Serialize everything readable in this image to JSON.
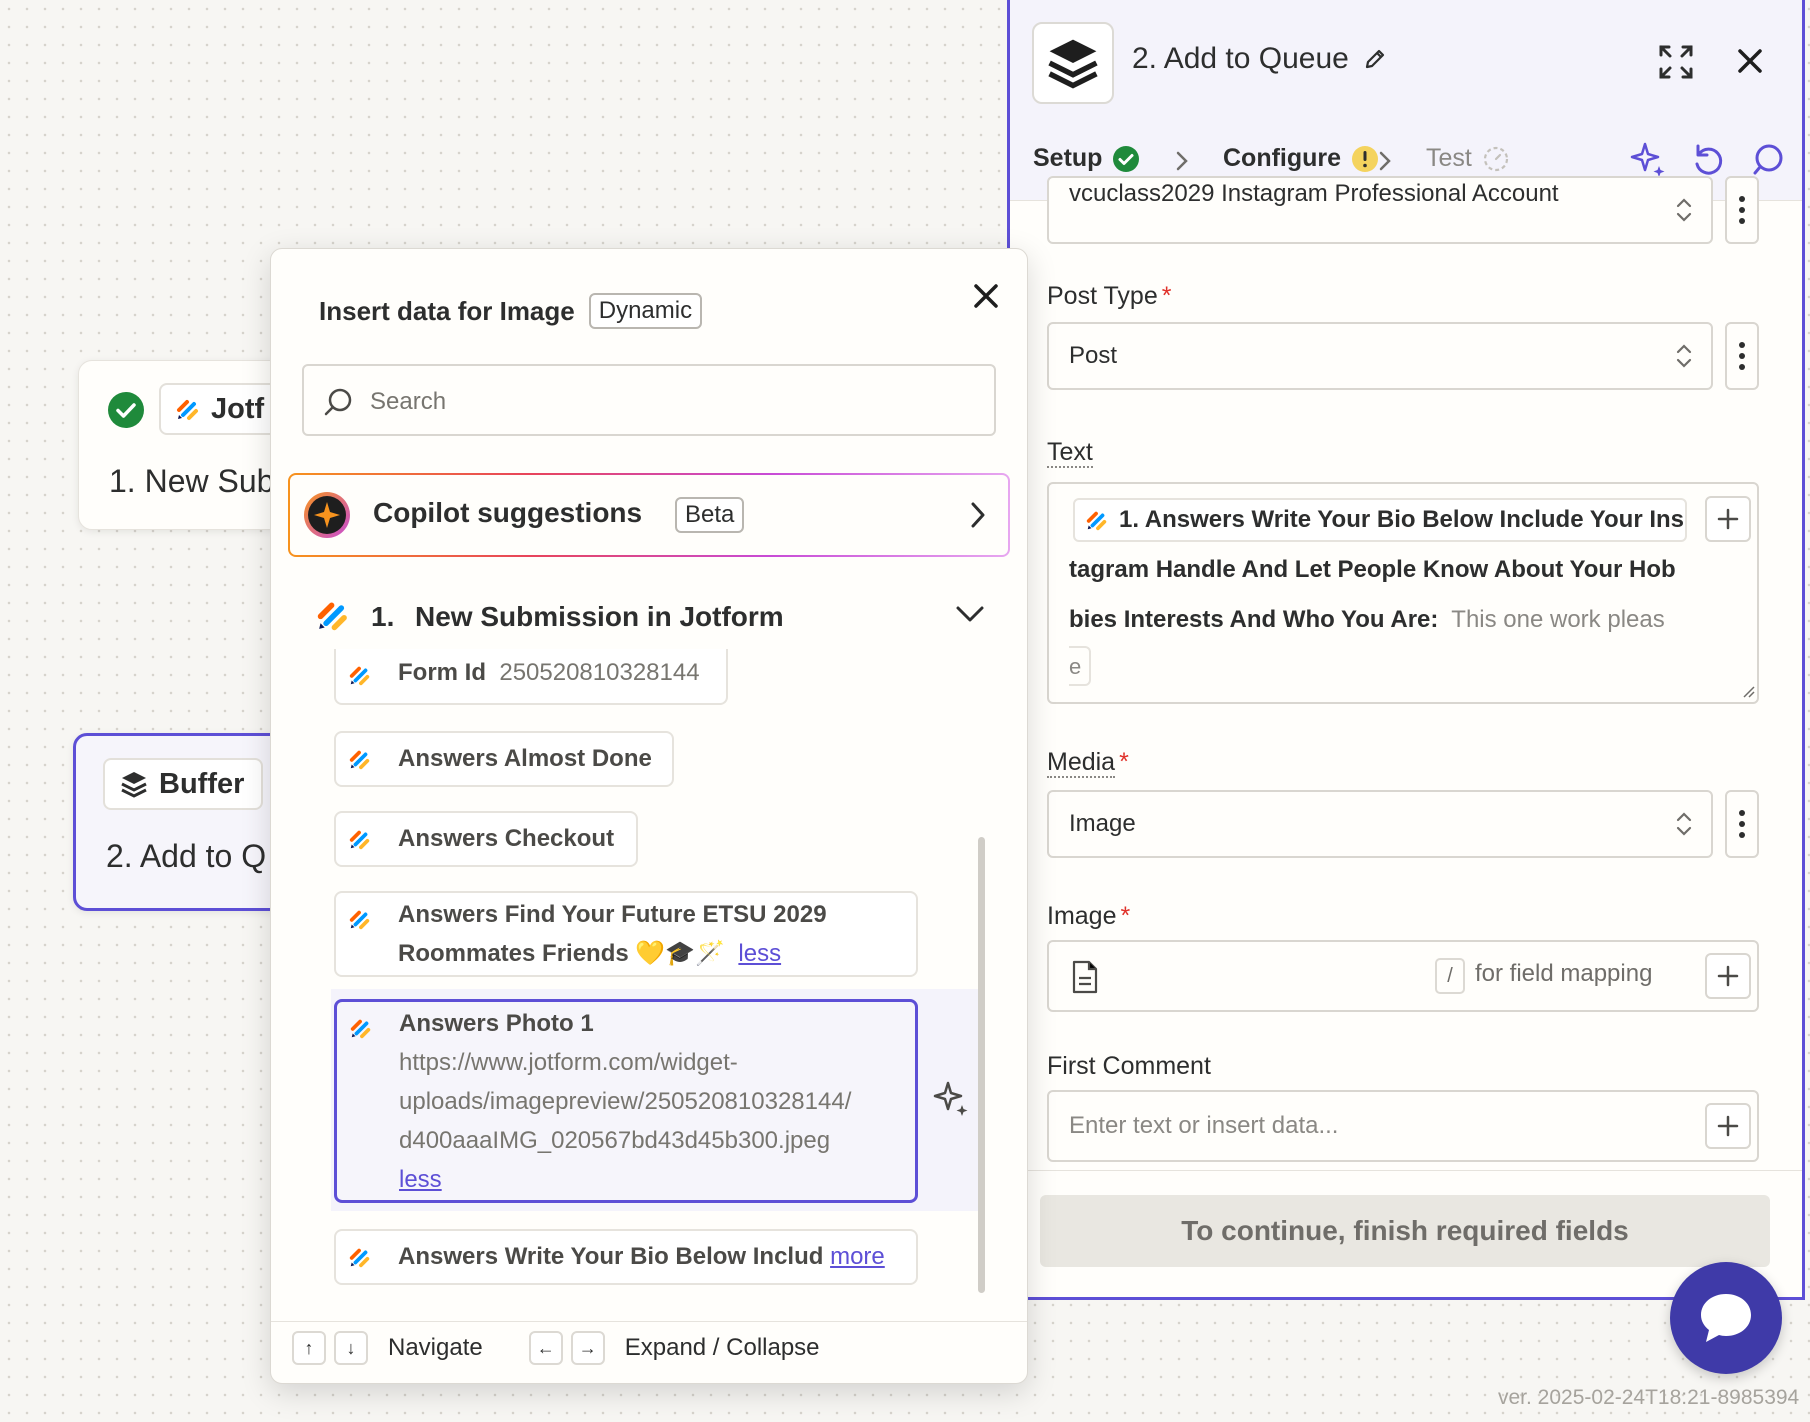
{
  "canvas": {
    "step1": {
      "app_label": "Jotf",
      "title": "1. New Sub"
    },
    "step2": {
      "app_label": "Buffer",
      "title": "2. Add to Q"
    }
  },
  "panel": {
    "title": "2. Add to Queue",
    "tabs": [
      {
        "label": "Setup",
        "status": "complete"
      },
      {
        "label": "Configure",
        "status": "warning"
      },
      {
        "label": "Test",
        "status": "pending"
      }
    ],
    "account_value": "vcuclass2029 Instagram Professional Account",
    "post_type": {
      "label": "Post Type",
      "value": "Post"
    },
    "text_field": {
      "label": "Text",
      "pill_label": "1. Answers Write Your Bio Below Include Your Ins",
      "line2": "tagram Handle And Let People Know About Your Hob",
      "line3_bold": "bies Interests And Who You Are:",
      "line3_value": "This one work pleas",
      "line4_value": "e"
    },
    "media": {
      "label": "Media",
      "value": "Image"
    },
    "image_field": {
      "label": "Image",
      "hint_key": "/",
      "hint": "for field mapping"
    },
    "first_comment": {
      "label": "First Comment",
      "placeholder": "Enter text or insert data..."
    },
    "continue_label": "To continue, finish required fields"
  },
  "popup": {
    "title": "Insert data for Image",
    "badge": "Dynamic",
    "search_placeholder": "Search",
    "copilot": {
      "label": "Copilot suggestions",
      "badge": "Beta"
    },
    "group": {
      "number": "1.",
      "title": "New Submission in Jotform"
    },
    "items": [
      {
        "label": "Form Id",
        "value": "250520810328144"
      },
      {
        "label": "Answers Almost Done"
      },
      {
        "label": "Answers Checkout"
      },
      {
        "label": "Answers Find Your Future ETSU 2029",
        "label2": "Roommates Friends 💛🎓🪄",
        "toggle": "less"
      },
      {
        "label": "Answers Photo 1",
        "url1": "https://www.jotform.com/widget-",
        "url2": "uploads/imagepreview/250520810328144/",
        "url3": "d400aaaIMG_020567bd43d45b300.jpeg",
        "toggle": "less"
      },
      {
        "label": "Answers Write Your Bio Below Includ",
        "toggle": "more"
      }
    ],
    "footer": {
      "up": "↑",
      "down": "↓",
      "navigate": "Navigate",
      "left": "←",
      "right": "→",
      "expand": "Expand / Collapse"
    }
  },
  "version": "ver. 2025-02-24T18:21-8985394",
  "colors": {
    "accent": "#5d4fd6",
    "success": "#1f8a3b",
    "warning": "#f4d35e",
    "required": "#e0312a"
  }
}
